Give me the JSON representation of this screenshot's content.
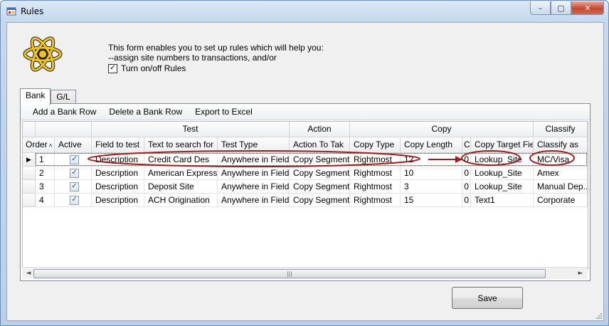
{
  "window": {
    "title": "Rules",
    "buttons": {
      "minimize": "–",
      "maximize": "▢",
      "close": "✕"
    }
  },
  "intro": {
    "line1": "This form enables you to set up rules which will help you:",
    "line2": "--assign site numbers to transactions, and/or"
  },
  "toggle": {
    "label": "Turn on/off Rules",
    "checked": true
  },
  "tabs": [
    "Bank",
    "G/L"
  ],
  "toolbar": {
    "add": "Add a Bank Row",
    "delete": "Delete a Bank Row",
    "export": "Export to Excel"
  },
  "grid": {
    "groups": {
      "test": "Test",
      "action": "Action",
      "copy": "Copy",
      "classify": "Classify"
    },
    "columns": {
      "order": "Order",
      "active": "Active",
      "field": "Field to test",
      "search": "Text to search for",
      "test_type": "Test Type",
      "action_to_take": "Action To Tak",
      "copy_type": "Copy Type",
      "copy_length": "Copy Length",
      "c": "C",
      "copy_target": "Copy Target Fiel",
      "classify_as": "Classify as"
    },
    "rows": [
      {
        "order": "1",
        "active": true,
        "field": "Description",
        "search": "Credit Card Des",
        "test_type": "Anywhere in Field",
        "action": "Copy Segment",
        "copy_type": "Rightmost",
        "copy_length": "12",
        "c": "0",
        "target": "Lookup_Site",
        "classify": "MC/Visa"
      },
      {
        "order": "2",
        "active": true,
        "field": "Description",
        "search": "American Express",
        "test_type": "Anywhere in Field",
        "action": "Copy Segment",
        "copy_type": "Rightmost",
        "copy_length": "10",
        "c": "0",
        "target": "Lookup_Site",
        "classify": "Amex"
      },
      {
        "order": "3",
        "active": true,
        "field": "Description",
        "search": "Deposit Site",
        "test_type": "Anywhere in Field",
        "action": "Copy Segment",
        "copy_type": "Rightmost",
        "copy_length": "3",
        "c": "0",
        "target": "Lookup_Site",
        "classify": "Manual Dep..."
      },
      {
        "order": "4",
        "active": true,
        "field": "Description",
        "search": "ACH Origination",
        "test_type": "Anywhere in Field",
        "action": "Copy Segment",
        "copy_type": "Rightmost",
        "copy_length": "15",
        "c": "0",
        "target": "Text1",
        "classify": "Corporate"
      }
    ]
  },
  "save_button": "Save",
  "colors": {
    "annotation": "#a31d1d",
    "titlebar": "#c4d8ee"
  }
}
